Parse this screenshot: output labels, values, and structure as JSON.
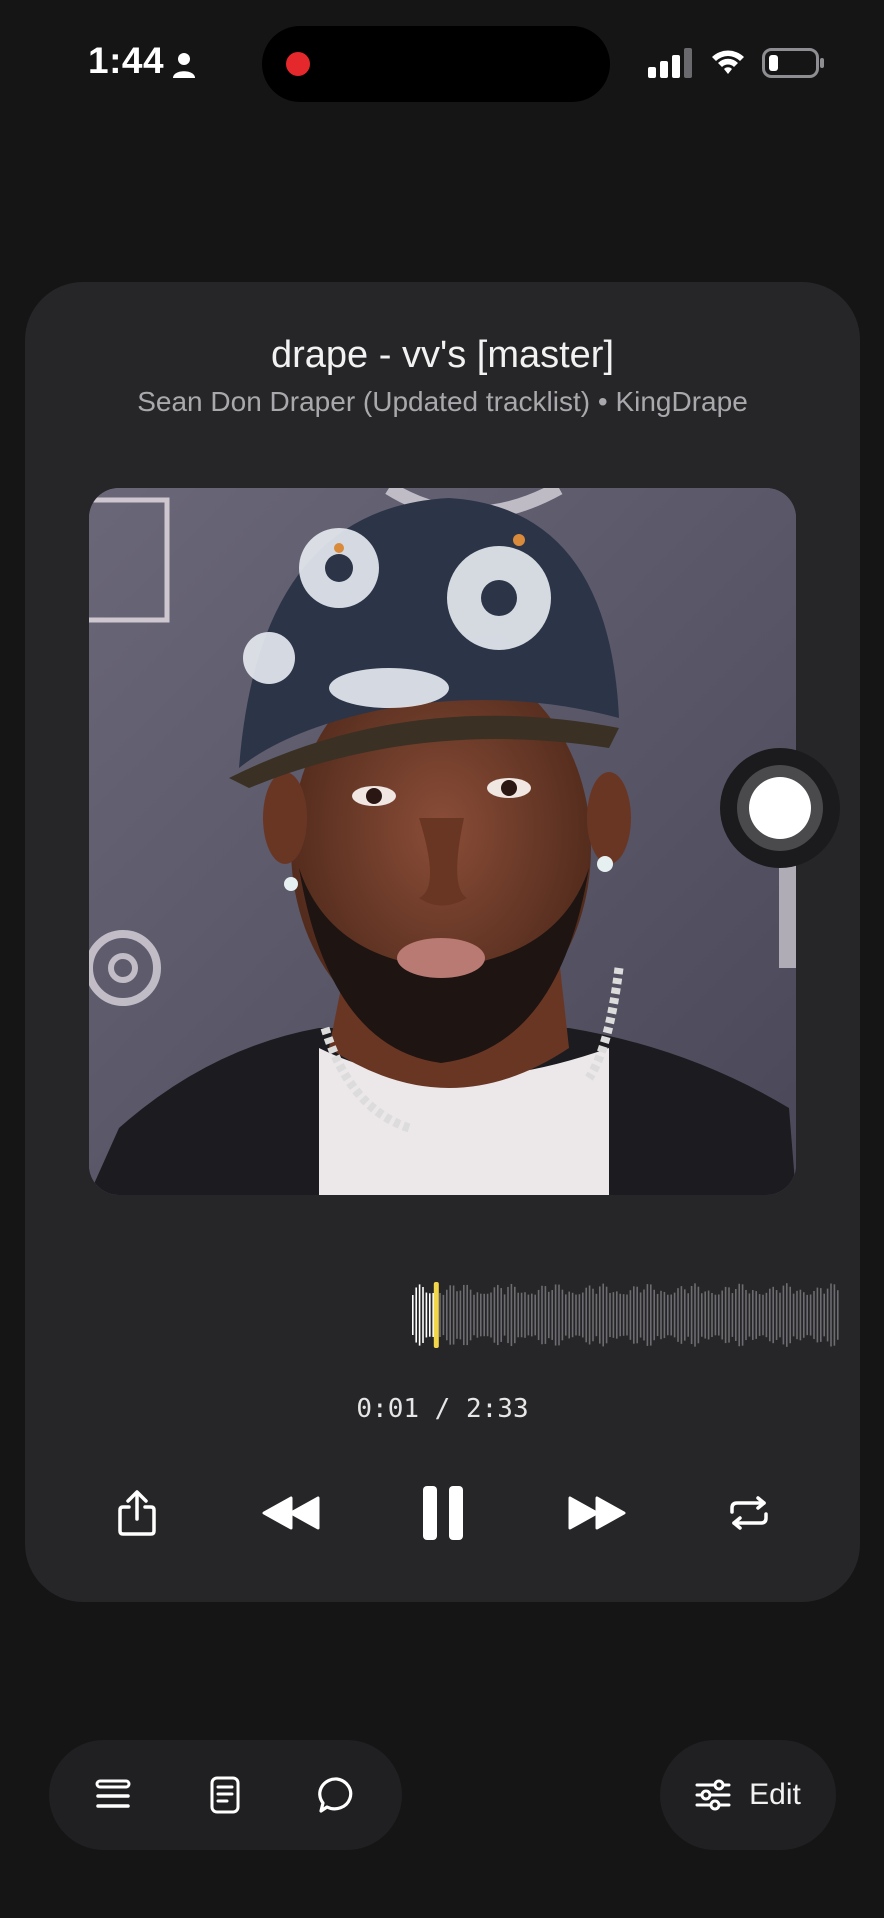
{
  "status_bar": {
    "time": "1:44",
    "icons": [
      "person-icon",
      "recording-dot",
      "cellular-signal-icon",
      "wifi-icon",
      "battery-icon"
    ]
  },
  "player": {
    "title": "drape - vv's [master]",
    "subtitle": "Sean Don Draper (Updated tracklist)  • KingDrape",
    "time_readout": "0:01 / 2:33",
    "progress_fraction": 0.0065,
    "accent_color": "#f3d74a",
    "controls": [
      "share-icon",
      "rewind-icon",
      "pause-icon",
      "fast-forward-icon",
      "repeat-icon"
    ]
  },
  "bottom_bar": {
    "icons": [
      "queue-icon",
      "notes-icon",
      "comment-icon"
    ],
    "edit_label": "Edit"
  }
}
